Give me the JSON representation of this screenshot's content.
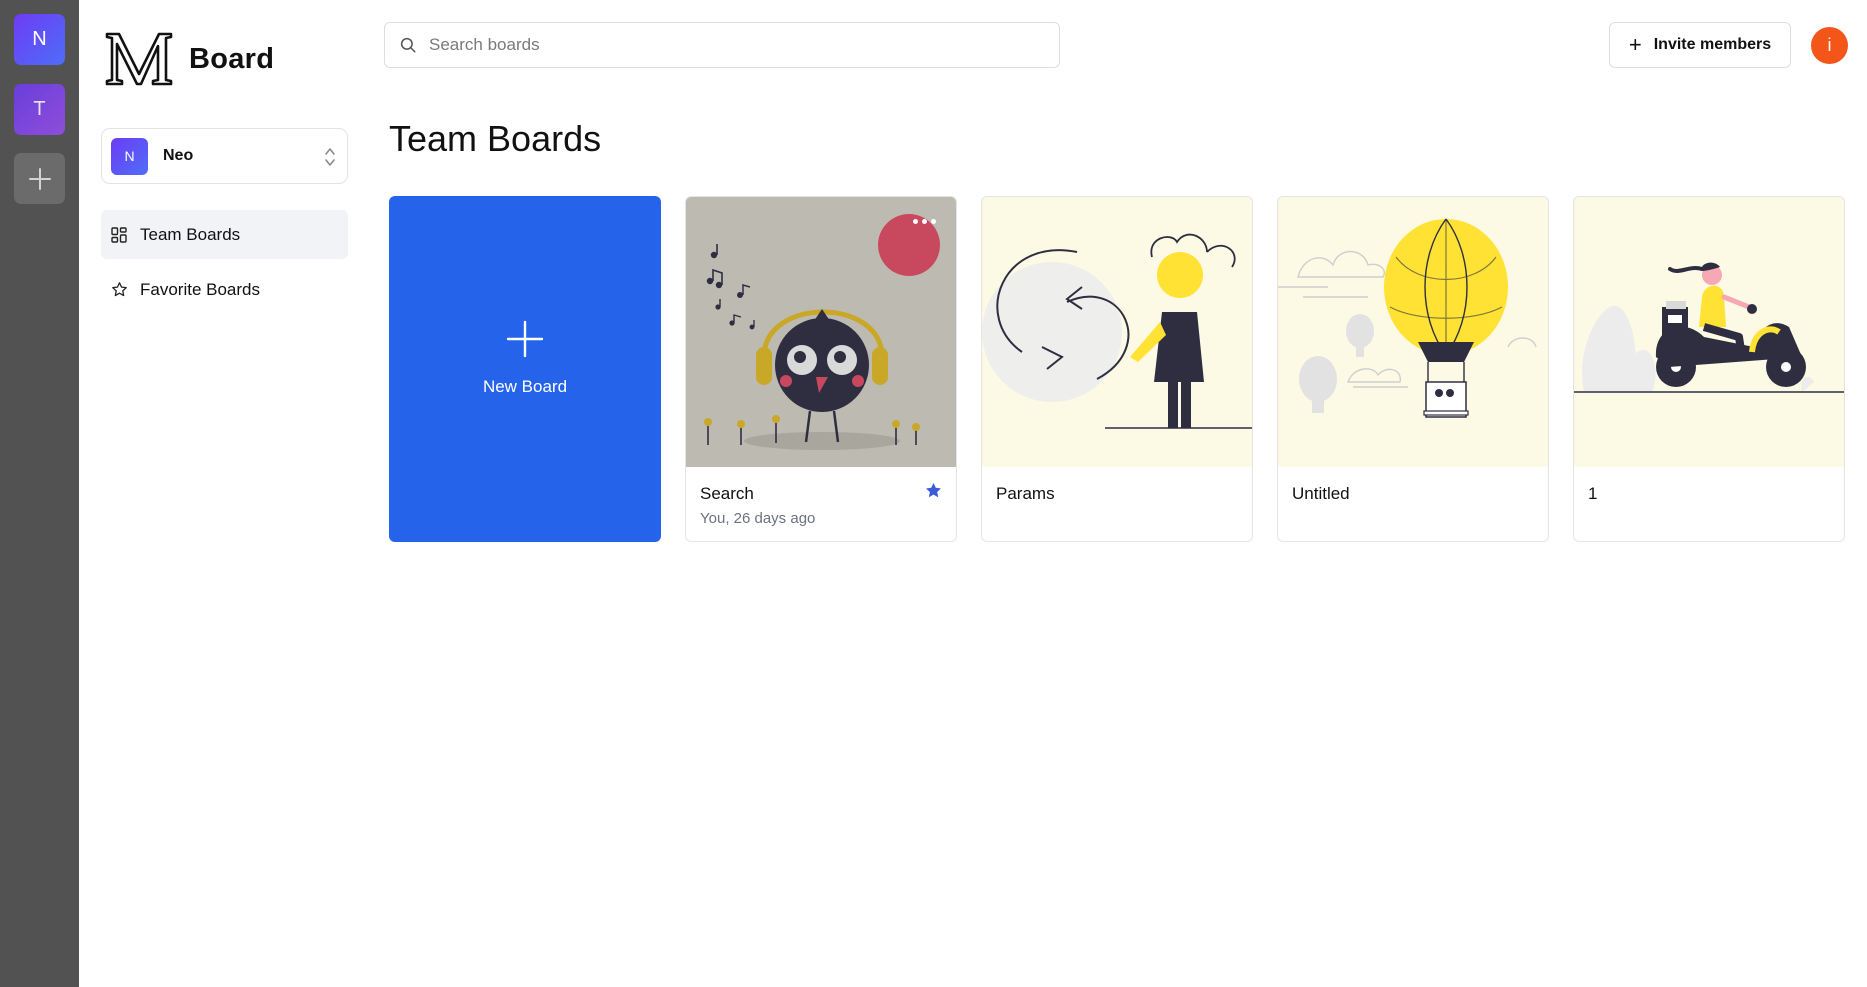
{
  "rail": {
    "orgs": [
      {
        "initial": "N",
        "color": "#5b54f6"
      },
      {
        "initial": "T",
        "color": "#8a4cf0"
      }
    ],
    "add_icon": "plus-icon"
  },
  "sidebar": {
    "logo_text": "Board",
    "org_selector": {
      "initial": "N",
      "name": "Neo"
    },
    "nav": [
      {
        "label": "Team Boards",
        "icon": "dashboard-grid-icon",
        "active": true
      },
      {
        "label": "Favorite Boards",
        "icon": "star-outline-icon",
        "active": false
      }
    ]
  },
  "header": {
    "search_placeholder": "Search boards",
    "invite_label": "Invite members",
    "user_initial": "i",
    "user_color": "#f45619"
  },
  "main": {
    "title": "Team Boards",
    "new_board_label": "New Board",
    "accent": "#2563eb",
    "boards": [
      {
        "title": "Search",
        "subtitle": "You, 26 days ago",
        "favorite": true,
        "illustration": "bird-headphones-illustration"
      },
      {
        "title": "Params",
        "subtitle": "",
        "favorite": false,
        "illustration": "woman-arrows-illustration"
      },
      {
        "title": "Untitled",
        "subtitle": "",
        "favorite": false,
        "illustration": "hot-air-balloon-illustration"
      },
      {
        "title": "1",
        "subtitle": "",
        "favorite": false,
        "illustration": "scooter-delivery-illustration"
      }
    ]
  }
}
